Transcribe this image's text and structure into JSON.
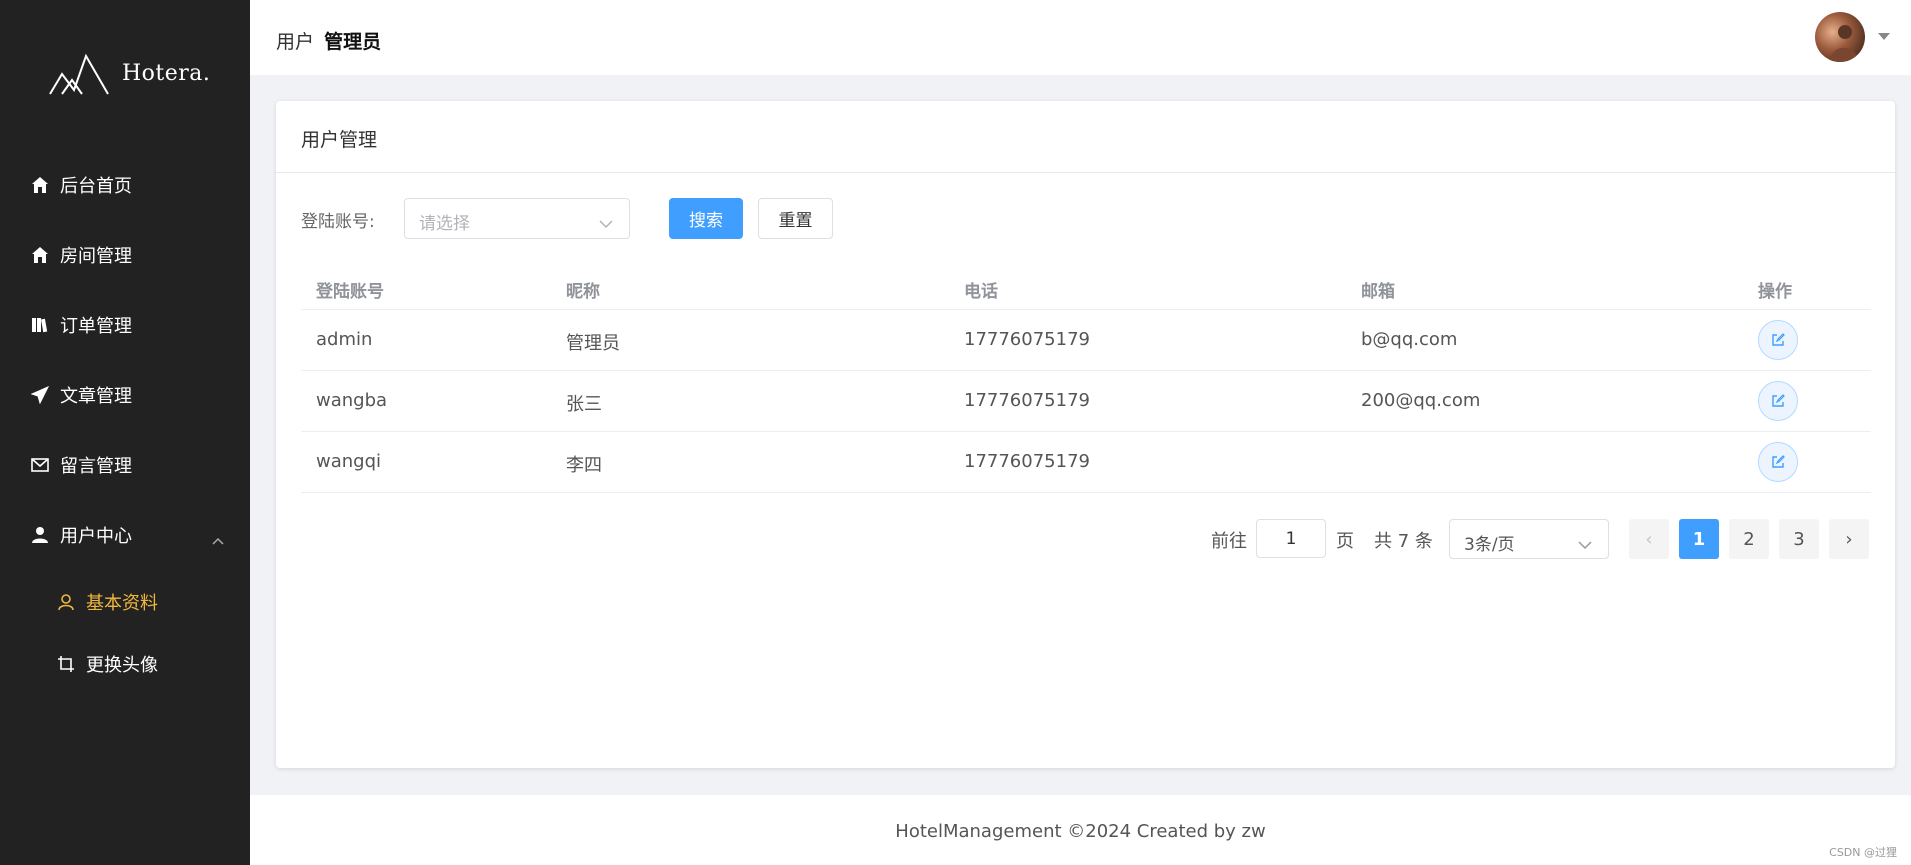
{
  "brand": {
    "name": "Hotera."
  },
  "sidebar": {
    "items": [
      {
        "label": "后台首页",
        "icon": "home-icon"
      },
      {
        "label": "房间管理",
        "icon": "home-icon"
      },
      {
        "label": "订单管理",
        "icon": "book-icon"
      },
      {
        "label": "文章管理",
        "icon": "send-icon"
      },
      {
        "label": "留言管理",
        "icon": "mail-icon"
      },
      {
        "label": "用户中心",
        "icon": "user-icon",
        "expanded": true
      }
    ],
    "sub_items": [
      {
        "label": "基本资料",
        "icon": "user-outline-icon",
        "active": true
      },
      {
        "label": "更换头像",
        "icon": "crop-icon"
      }
    ],
    "active_color": "#f0b73f"
  },
  "header": {
    "breadcrumb_prefix": "用户",
    "breadcrumb_user": "管理员"
  },
  "card": {
    "title": "用户管理",
    "search": {
      "label": "登陆账号:",
      "placeholder": "请选择",
      "search_button": "搜索",
      "reset_button": "重置"
    },
    "table": {
      "headers": [
        "登陆账号",
        "昵称",
        "电话",
        "邮箱",
        "操作"
      ],
      "rows": [
        {
          "account": "admin",
          "nickname": "管理员",
          "phone": "17776075179",
          "email": "b@qq.com"
        },
        {
          "account": "wangba",
          "nickname": "张三",
          "phone": "17776075179",
          "email": "200@qq.com"
        },
        {
          "account": "wangqi",
          "nickname": "李四",
          "phone": "17776075179",
          "email": ""
        }
      ]
    },
    "pagination": {
      "goto_label": "前往",
      "goto_value": "1",
      "page_label": "页",
      "total_text": "共 7 条",
      "page_size": "3条/页",
      "prev": "‹",
      "next": "›",
      "pages": [
        "1",
        "2",
        "3"
      ],
      "current": 1
    }
  },
  "footer": {
    "text": "HotelManagement ©2024 Created by zw"
  },
  "watermark": "CSDN @过狸",
  "colors": {
    "primary": "#409eff",
    "sidebar_bg": "#222222"
  }
}
